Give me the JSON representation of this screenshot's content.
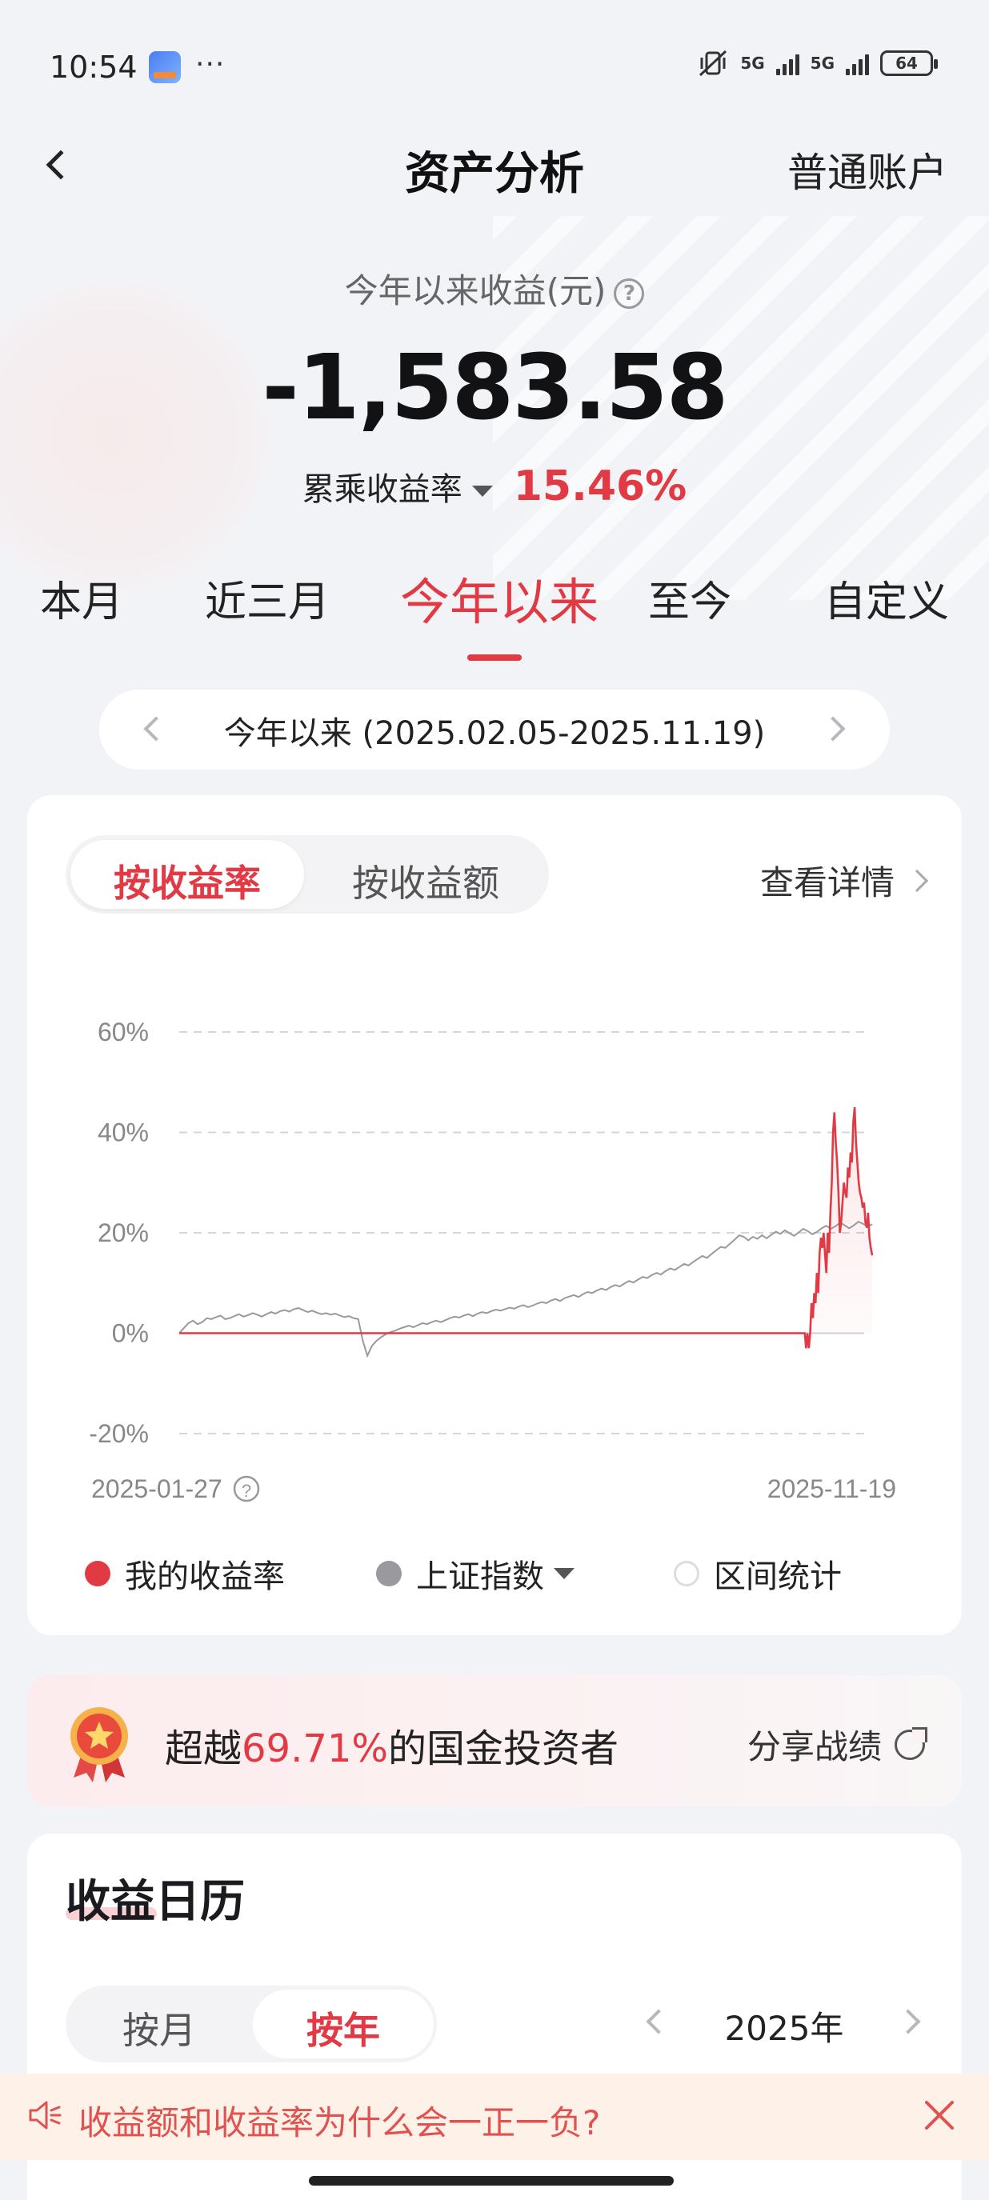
{
  "status_bar": {
    "time": "10:54",
    "dots": "···",
    "network_1": "5G",
    "network_2": "5G",
    "battery": "64"
  },
  "nav": {
    "title": "资产分析",
    "account": "普通账户"
  },
  "summary": {
    "label": "今年以来收益(元)",
    "amount": "-1,583.58",
    "rate_label": "累乘收益率",
    "rate_value": "15.46%"
  },
  "period_tabs": [
    "本月",
    "近三月",
    "今年以来",
    "至今",
    "自定义"
  ],
  "active_period": "今年以来",
  "range": {
    "text": "今年以来 (2025.02.05-2025.11.19)"
  },
  "chart_card": {
    "toggle_on": "按收益率",
    "toggle_off": "按收益额",
    "detail": "查看详情"
  },
  "chart_data": {
    "type": "line",
    "y_ticks": [
      "60%",
      "40%",
      "20%",
      "0%",
      "-20%"
    ],
    "ylim": [
      -20,
      60
    ],
    "x_start": "2025-01-27",
    "x_end": "2025-11-19",
    "grid": true,
    "series": [
      {
        "name": "我的收益率",
        "color": "#e23a44",
        "area": true,
        "values": [
          0,
          0,
          0,
          0,
          0,
          0,
          0,
          0,
          0,
          0,
          0,
          0,
          0,
          0,
          0,
          0,
          0,
          0,
          0,
          0,
          0,
          0,
          0,
          0,
          0,
          0,
          0,
          0,
          0,
          0,
          0,
          0,
          0,
          0,
          0,
          0,
          0,
          0,
          0,
          0,
          0,
          0,
          0,
          0,
          0,
          0,
          0,
          0,
          0,
          0,
          0,
          0,
          0,
          0,
          0,
          0,
          0,
          0,
          0,
          0,
          0,
          0,
          0,
          0,
          0,
          0,
          0,
          0,
          0,
          0,
          0,
          0,
          0,
          0,
          0,
          0,
          0,
          0,
          0,
          0,
          0,
          0,
          0,
          0,
          0,
          0,
          0,
          0,
          0,
          0,
          0,
          0,
          0,
          0,
          0,
          0,
          0,
          0,
          0,
          0,
          0,
          0,
          0,
          0,
          0,
          0,
          0,
          0,
          0,
          0,
          0,
          0,
          0,
          0,
          0,
          0,
          0,
          0,
          0,
          0,
          0,
          0,
          0,
          0,
          0,
          0,
          0,
          0,
          0,
          0,
          0,
          0,
          0,
          0,
          0,
          0,
          0,
          0,
          0,
          0,
          0,
          0,
          0,
          0,
          0,
          0,
          0,
          0,
          0,
          0,
          0,
          0,
          0,
          0,
          0,
          0,
          0,
          0,
          0,
          0,
          0,
          0,
          0,
          0,
          0,
          0,
          0,
          0,
          0,
          0,
          0,
          0,
          0,
          0,
          0,
          0,
          0,
          0,
          0,
          0,
          0,
          0,
          0,
          0,
          0,
          0,
          0,
          0,
          0,
          0,
          0,
          0,
          0,
          0,
          0,
          0,
          0,
          0,
          0,
          0,
          0,
          0,
          0,
          0,
          0,
          0,
          0,
          0,
          0,
          0,
          0,
          0,
          0,
          0,
          0,
          0,
          0,
          0,
          0,
          0,
          0,
          0,
          0,
          0,
          0,
          0,
          0,
          0,
          0,
          0,
          0,
          0,
          0,
          0,
          0,
          0,
          0,
          0,
          0,
          0,
          0,
          0,
          0,
          0,
          0,
          0,
          0,
          0,
          0,
          0,
          0,
          0,
          0,
          0,
          0,
          0,
          0,
          0,
          0,
          0,
          0,
          0,
          0,
          0,
          0,
          0,
          0,
          0,
          0,
          0,
          0,
          0,
          0,
          0,
          0,
          0,
          0,
          0,
          0,
          0,
          0,
          0,
          0,
          0,
          0,
          0,
          0,
          0,
          0,
          0,
          0,
          0,
          0,
          0,
          0,
          0,
          0,
          0,
          0,
          0,
          0,
          0,
          0,
          0,
          0,
          0,
          0,
          0,
          0,
          0,
          0,
          0,
          0,
          0,
          0,
          0,
          0,
          0,
          0,
          0,
          0,
          0,
          0,
          0,
          0,
          0,
          0,
          0,
          0,
          0,
          0,
          0,
          0,
          0,
          0,
          0,
          0,
          0,
          0,
          0,
          0,
          0,
          0,
          0,
          0,
          0,
          0,
          0,
          0,
          0,
          0,
          0,
          0,
          0,
          0,
          0,
          0,
          0,
          0,
          0,
          0,
          0,
          0,
          0,
          0,
          0,
          0,
          0,
          0,
          0,
          0,
          0,
          0,
          0,
          0,
          0,
          0,
          0,
          0,
          0,
          0,
          0,
          0,
          0,
          0,
          0,
          0,
          0,
          0,
          0,
          0,
          0,
          0,
          0,
          0,
          0,
          0,
          0,
          0,
          0,
          0,
          0,
          0,
          0,
          0,
          0,
          0,
          0,
          0,
          0,
          0,
          0,
          0,
          0,
          0,
          0,
          0,
          0,
          0,
          0,
          0,
          0,
          0,
          0,
          0,
          0,
          0,
          0,
          0,
          0,
          0,
          0,
          0,
          0,
          0,
          0,
          0,
          0,
          0,
          0,
          0,
          0,
          0,
          0,
          0,
          0,
          0,
          0,
          0,
          0,
          0,
          0,
          0,
          0,
          0,
          0,
          0,
          0,
          0,
          0,
          0,
          0,
          0,
          0,
          0,
          -3,
          0,
          -3,
          0,
          6,
          3,
          8,
          6,
          12,
          8,
          16,
          19,
          17,
          20,
          16,
          12,
          20,
          16,
          24,
          30,
          40,
          44,
          38,
          34,
          28,
          20,
          22,
          26,
          30,
          28,
          27,
          33,
          31,
          36,
          34,
          42,
          45,
          38,
          34,
          30,
          28,
          27,
          25,
          26,
          22,
          21,
          24,
          19,
          17,
          15.5
        ]
      },
      {
        "name": "上证指数",
        "color": "#9a9a9e",
        "area": false,
        "values": [
          0,
          1,
          2,
          2.5,
          1.8,
          2.2,
          3,
          2.8,
          3.2,
          3.5,
          2.8,
          3,
          3.4,
          3.8,
          3.3,
          3.6,
          4,
          3.7,
          3.3,
          3.8,
          4.2,
          3.9,
          4.4,
          4.6,
          4.3,
          4.8,
          5,
          4.6,
          4.2,
          4.5,
          4.1,
          3.8,
          4,
          3.7,
          3.9,
          3.5,
          3.2,
          3.4,
          3,
          2.8,
          -1.5,
          -4.5,
          -2.5,
          -1.5,
          -0.8,
          -0.2,
          0.2,
          0.5,
          0.9,
          1.2,
          1.5,
          1.2,
          1.6,
          2,
          1.8,
          2.2,
          2.5,
          2.2,
          2.6,
          3,
          3.3,
          3.1,
          3.5,
          3.8,
          3.4,
          3.9,
          4.2,
          4,
          4.4,
          4.7,
          4.5,
          4.8,
          5.1,
          4.9,
          5.3,
          5.6,
          5.2,
          5.5,
          5.9,
          6.2,
          6,
          6.5,
          6.8,
          6.4,
          7,
          7.3,
          7.6,
          7.2,
          7.8,
          8.2,
          8,
          8.5,
          8.9,
          8.6,
          9.2,
          9.6,
          9.3,
          9.9,
          10.4,
          10.1,
          10.7,
          11.2,
          11,
          11.6,
          12,
          11.7,
          12.4,
          12.9,
          12.6,
          13.2,
          13.8,
          13.5,
          14.2,
          14.8,
          15.4,
          15,
          15.8,
          16.5,
          17.2,
          17,
          17.8,
          18.6,
          19.5,
          19.2,
          18.5,
          19.2,
          18.8,
          19.5,
          18.9,
          19.6,
          20.2,
          19.8,
          20.5,
          19.9,
          19.4,
          20.1,
          20.8,
          20.3,
          19.7,
          20.2,
          20.9,
          21.4,
          20.8,
          21.3,
          22,
          21.5,
          20.9,
          21.5,
          22.2,
          21.8,
          21.2,
          21.7
        ]
      }
    ]
  },
  "legend": {
    "mine": "我的收益率",
    "index": "上证指数",
    "stats": "区间统计"
  },
  "beat": {
    "prefix": "超越",
    "pct": "69.71%",
    "suffix": "的国金投资者",
    "share": "分享战绩"
  },
  "calendar": {
    "title": "收益日历",
    "by_month": "按月",
    "by_year": "按年",
    "year": "2025年"
  },
  "notice": {
    "text": "收益额和收益率为什么会一正一负?"
  }
}
